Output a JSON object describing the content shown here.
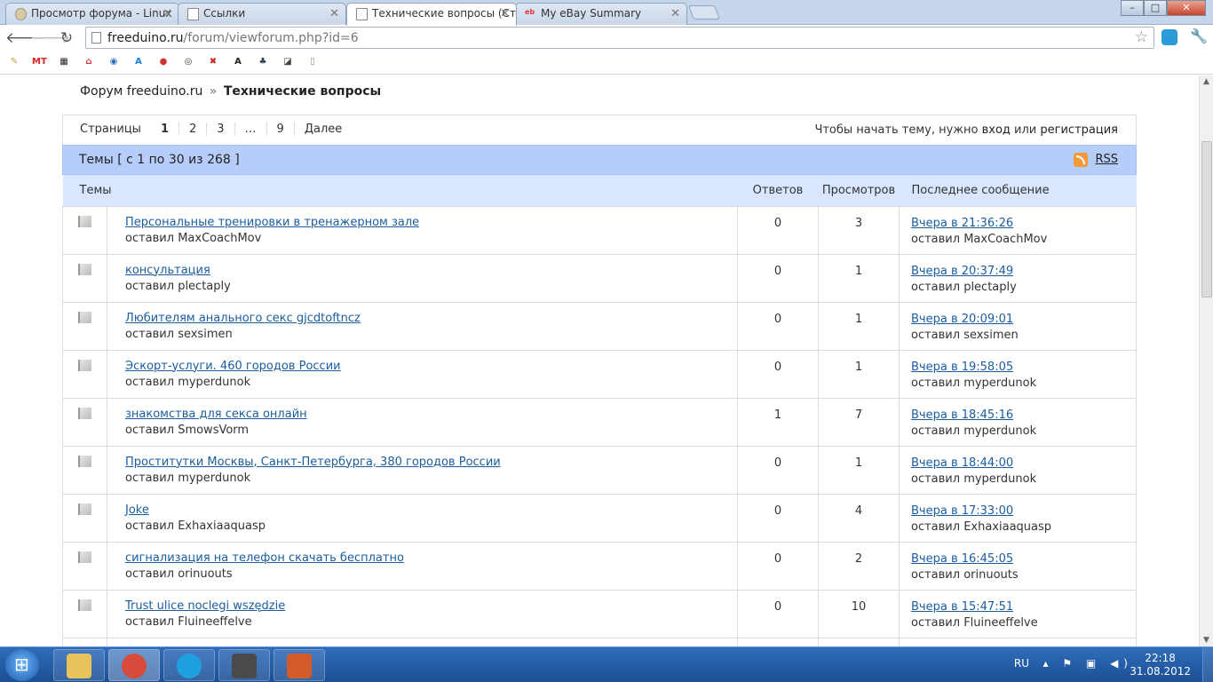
{
  "browser": {
    "tabs": [
      {
        "label": "Просмотр форума - Linux",
        "active": false
      },
      {
        "label": "Ссылки",
        "active": false
      },
      {
        "label": "Технические вопросы (Ст",
        "active": true
      },
      {
        "label": "My eBay Summary",
        "active": false
      }
    ],
    "url_host": "freeduino.ru",
    "url_path": "/forum/viewforum.php?id=6",
    "window_controls": {
      "minimize": "–",
      "maximize": "□",
      "close": "✕"
    }
  },
  "bookmarks": [
    {
      "icon": "edit-icon",
      "text": "✎",
      "color": "#c9a43a"
    },
    {
      "icon": "mt-icon",
      "text": "MT",
      "color": "#d22"
    },
    {
      "icon": "clapper-icon",
      "text": "▦",
      "color": "#222"
    },
    {
      "icon": "home-icon",
      "text": "⌂",
      "color": "#c33"
    },
    {
      "icon": "yandex-icon",
      "text": "◉",
      "color": "#2c6fc1"
    },
    {
      "icon": "translate-icon",
      "text": "A",
      "color": "#1a7fd6"
    },
    {
      "icon": "ball-icon",
      "text": "●",
      "color": "#c33"
    },
    {
      "icon": "disc-icon",
      "text": "◎",
      "color": "#444"
    },
    {
      "icon": "cross-icon",
      "text": "✖",
      "color": "#c22"
    },
    {
      "icon": "arch-icon",
      "text": "A",
      "color": "#222"
    },
    {
      "icon": "tree-icon",
      "text": "♣",
      "color": "#345"
    },
    {
      "icon": "cube-icon",
      "text": "◪",
      "color": "#444"
    },
    {
      "icon": "page-icon",
      "text": "▯",
      "color": "#888"
    }
  ],
  "breadcrumb": {
    "forum": "Форум freeduino.ru",
    "sep": "»",
    "current": "Технические вопросы"
  },
  "pagination": {
    "label": "Страницы",
    "pages": [
      "1",
      "2",
      "3",
      "…",
      "9"
    ],
    "current": "1",
    "next": "Далее"
  },
  "login_msg": {
    "prefix": "Чтобы начать тему, нужно",
    "login": "вход",
    "or": "или",
    "register": "регистрация"
  },
  "topics_header": {
    "title": "Темы [ с 1 по 30 из 268 ]",
    "rss": "RSS"
  },
  "columns": {
    "topic": "Темы",
    "replies": "Ответов",
    "views": "Просмотров",
    "last": "Последнее сообщение"
  },
  "topics": [
    {
      "title": "Персональные тренировки в тренажерном зале",
      "author": "оставил MaxCoachMov",
      "replies": "0",
      "views": "3",
      "last_time": "Вчера в 21:36:26",
      "last_author": "оставил MaxCoachMov"
    },
    {
      "title": "консультация",
      "author": "оставил plectaply",
      "replies": "0",
      "views": "1",
      "last_time": "Вчера в 20:37:49",
      "last_author": "оставил plectaply"
    },
    {
      "title": "Любителям анального секс gjcdtoftncz",
      "author": "оставил sexsimen",
      "replies": "0",
      "views": "1",
      "last_time": "Вчера в 20:09:01",
      "last_author": "оставил sexsimen"
    },
    {
      "title": "Эскорт-услуги. 460 городов России",
      "author": "оставил myperdunok",
      "replies": "0",
      "views": "1",
      "last_time": "Вчера в 19:58:05",
      "last_author": "оставил myperdunok"
    },
    {
      "title": "знакомства для секса онлайн",
      "author": "оставил SmowsVorm",
      "replies": "1",
      "views": "7",
      "last_time": "Вчера в 18:45:16",
      "last_author": "оставил myperdunok"
    },
    {
      "title": "Проститутки Москвы, Санкт-Петербурга, 380 городов России",
      "author": "оставил myperdunok",
      "replies": "0",
      "views": "1",
      "last_time": "Вчера в 18:44:00",
      "last_author": "оставил myperdunok"
    },
    {
      "title": "Joke",
      "author": "оставил Exhaxiaaquasp",
      "replies": "0",
      "views": "4",
      "last_time": "Вчера в 17:33:00",
      "last_author": "оставил Exhaxiaaquasp"
    },
    {
      "title": "сигнализация на телефон скачать бесплатно",
      "author": "оставил orinuouts",
      "replies": "0",
      "views": "2",
      "last_time": "Вчера в 16:45:05",
      "last_author": "оставил orinuouts"
    },
    {
      "title": "Trust ulice noclegi wszędzie",
      "author": "оставил Fluineeffelve",
      "replies": "0",
      "views": "10",
      "last_time": "Вчера в 15:47:51",
      "last_author": "оставил Fluineeffelve"
    }
  ],
  "taskbar": {
    "apps": [
      {
        "name": "explorer-icon",
        "color": "#e8c25a",
        "active": false
      },
      {
        "name": "chrome-icon",
        "color": "#d84a3a",
        "active": true
      },
      {
        "name": "skype-icon",
        "color": "#1ea0e0",
        "active": false
      },
      {
        "name": "terminal-icon",
        "color": "#4a4a4a",
        "active": false
      },
      {
        "name": "presentation-icon",
        "color": "#d35a2a",
        "active": false
      }
    ],
    "lang": "RU",
    "tray_icons": "▴ ⚑ ▣ ◀)",
    "time": "22:18",
    "date": "31.08.2012"
  }
}
